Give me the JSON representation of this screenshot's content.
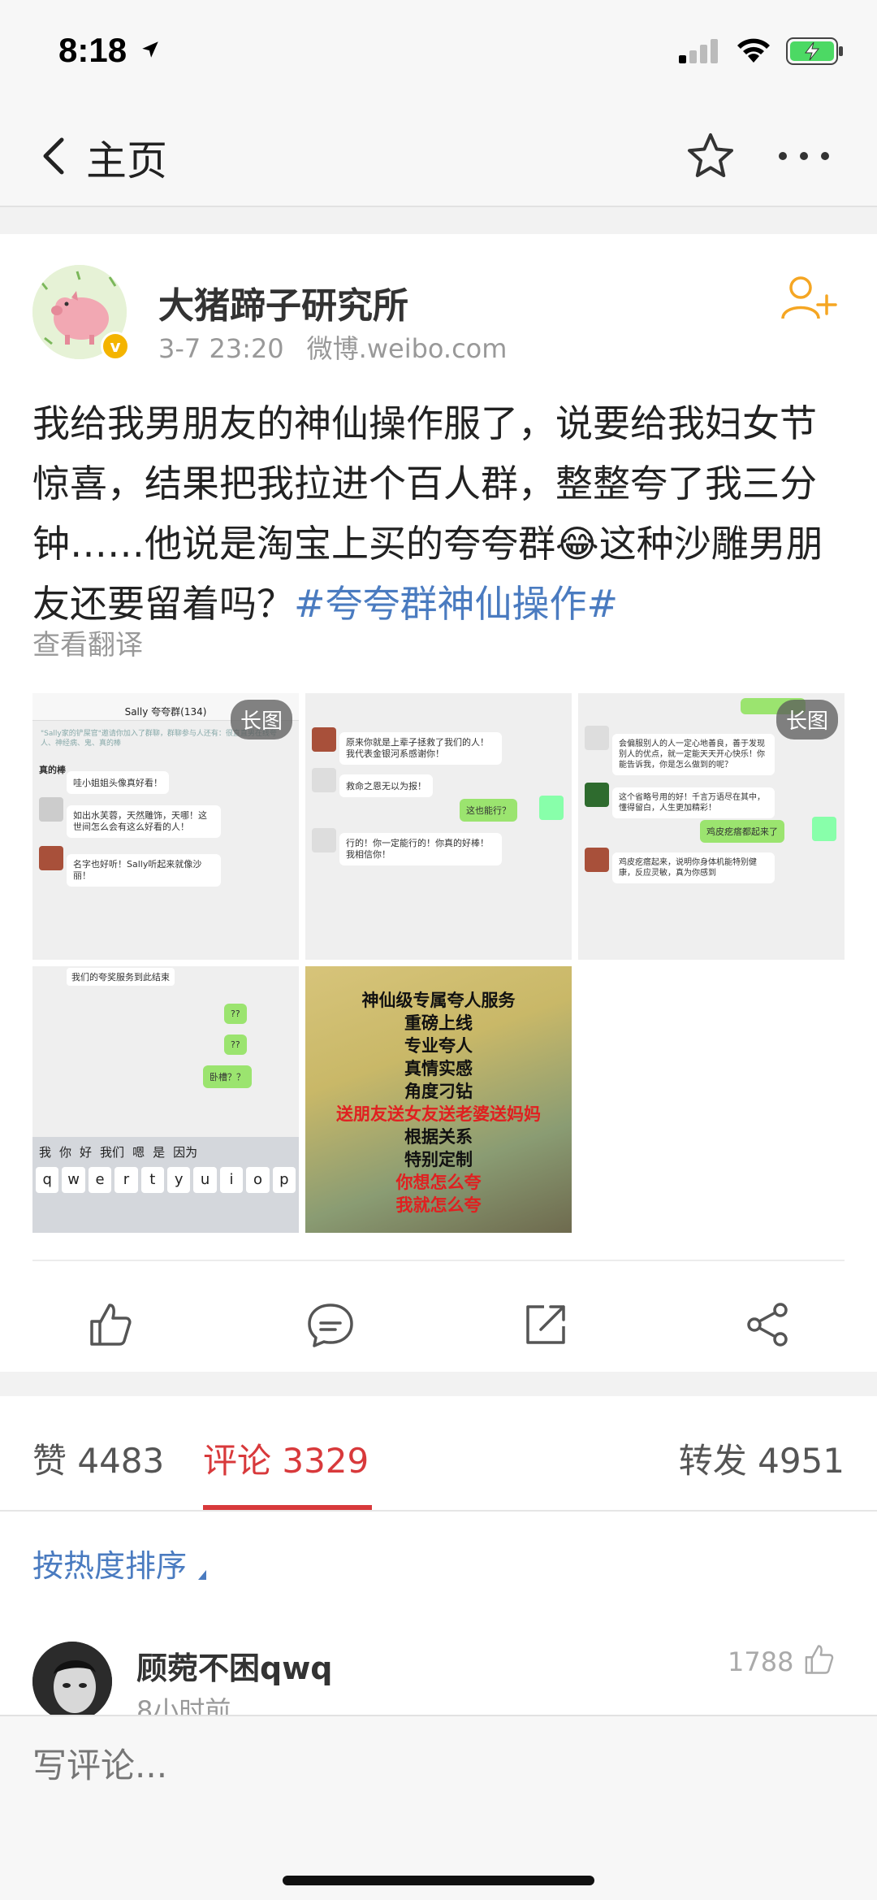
{
  "status_bar": {
    "time": "8:18"
  },
  "nav": {
    "back_label": "主页"
  },
  "post": {
    "author": "大猪蹄子研究所",
    "time": "3-7 23:20",
    "source": "微博.weibo.com",
    "text_main": "我给我男朋友的神仙操作服了，说要给我妇女节惊喜，结果把我拉进个百人群，整整夸了我三分钟……他说是淘宝上买的夸夸群😂这种沙雕男朋友还要留着吗？",
    "hashtag": "#夸夸群神仙操作#",
    "translate": "查看翻译",
    "long_image_tag": "长图",
    "images": {
      "img1": {
        "header": "Sally 夸夸群(134)",
        "b1": "哇小姐姐头像真好看！",
        "b2": "如出水芙蓉，天然雕饰，天哪！这世间怎么会有这么好看的人！",
        "b3": "名字也好听！Sally听起来就像沙丽！",
        "s1": "真的棒"
      },
      "img2": {
        "b1": "原来你就是上辈子拯救了我们的人！我代表金银河系感谢你！",
        "b2": "救命之恩无以为报！",
        "b3": "这也能行？",
        "b4": "行的！你一定能行的！你真的好棒！我相信你！"
      },
      "img3": {
        "b1": "会偏服别人的人一定心地善良，善于发现别人的优点，就一定能天天开心快乐！你能告诉我，你是怎么做到的呢？",
        "b2": "这个省略号用的好！千言万语尽在其中，懂得留白，人生更加精彩！",
        "b3": "鸡皮疙瘩都起来了",
        "b4": "鸡皮疙瘩起来，说明你身体机能特别健康，反应灵敏，真为你感到"
      },
      "img4": {
        "top": "我们的夸奖服务到此结束",
        "b1": "??",
        "b2": "??",
        "b3": "卧槽？？",
        "kb_row": [
          "我",
          "你",
          "好",
          "我们",
          "嗯",
          "是",
          "因为"
        ],
        "kb_keys": [
          "q",
          "w",
          "e",
          "r",
          "t",
          "y",
          "u",
          "i",
          "o",
          "p"
        ]
      },
      "img5": {
        "lines": [
          "神仙级专属夸人服务",
          "重磅上线",
          "专业夸人",
          "真情实感",
          "角度刁钻",
          "送朋友送女友送老婆送妈妈",
          "根据关系",
          "特别定制",
          "你想怎么夸",
          "我就怎么夸"
        ]
      }
    }
  },
  "tabs": {
    "likes": "赞 4483",
    "comments": "评论 3329",
    "reposts": "转发 4951"
  },
  "sort_label": "按热度排序",
  "comment": {
    "name": "顾菀不困qwq",
    "time": "8小时前",
    "likes": "1788"
  },
  "composer": {
    "placeholder": "写评论..."
  },
  "colors": {
    "accent_red": "#d8393b",
    "link_blue": "#4a7bc0",
    "follow_orange": "#f5a623"
  }
}
